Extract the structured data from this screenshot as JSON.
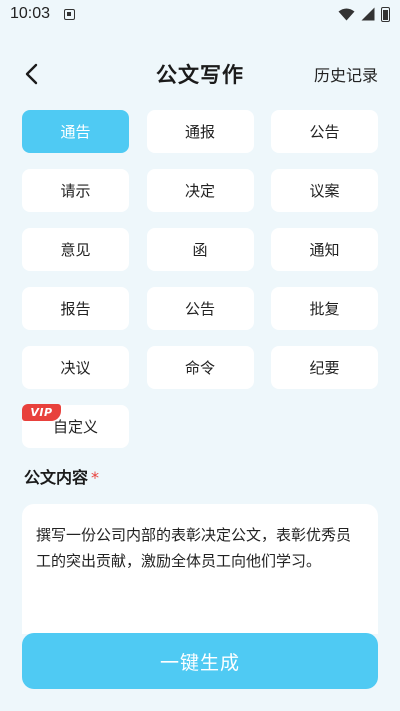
{
  "status_bar": {
    "time": "10:03"
  },
  "header": {
    "title": "公文写作",
    "history_label": "历史记录"
  },
  "doc_types": [
    {
      "label": "通告",
      "active": true
    },
    {
      "label": "通报"
    },
    {
      "label": "公告"
    },
    {
      "label": "请示"
    },
    {
      "label": "决定"
    },
    {
      "label": "议案"
    },
    {
      "label": "意见"
    },
    {
      "label": "函"
    },
    {
      "label": "通知"
    },
    {
      "label": "报告"
    },
    {
      "label": "公告"
    },
    {
      "label": "批复"
    },
    {
      "label": "决议"
    },
    {
      "label": "命令"
    },
    {
      "label": "纪要"
    },
    {
      "label": "自定义",
      "badge": "VIP"
    }
  ],
  "content": {
    "label": "公文内容",
    "required_mark": "*",
    "text": "撰写一份公司内部的表彰决定公文，表彰优秀员工的突出贡献，激励全体员工向他们学习。"
  },
  "generate_button": {
    "label": "一键生成"
  },
  "colors": {
    "accent": "#4fcaf3",
    "vip": "#e8413c",
    "background": "#eef7fb"
  }
}
